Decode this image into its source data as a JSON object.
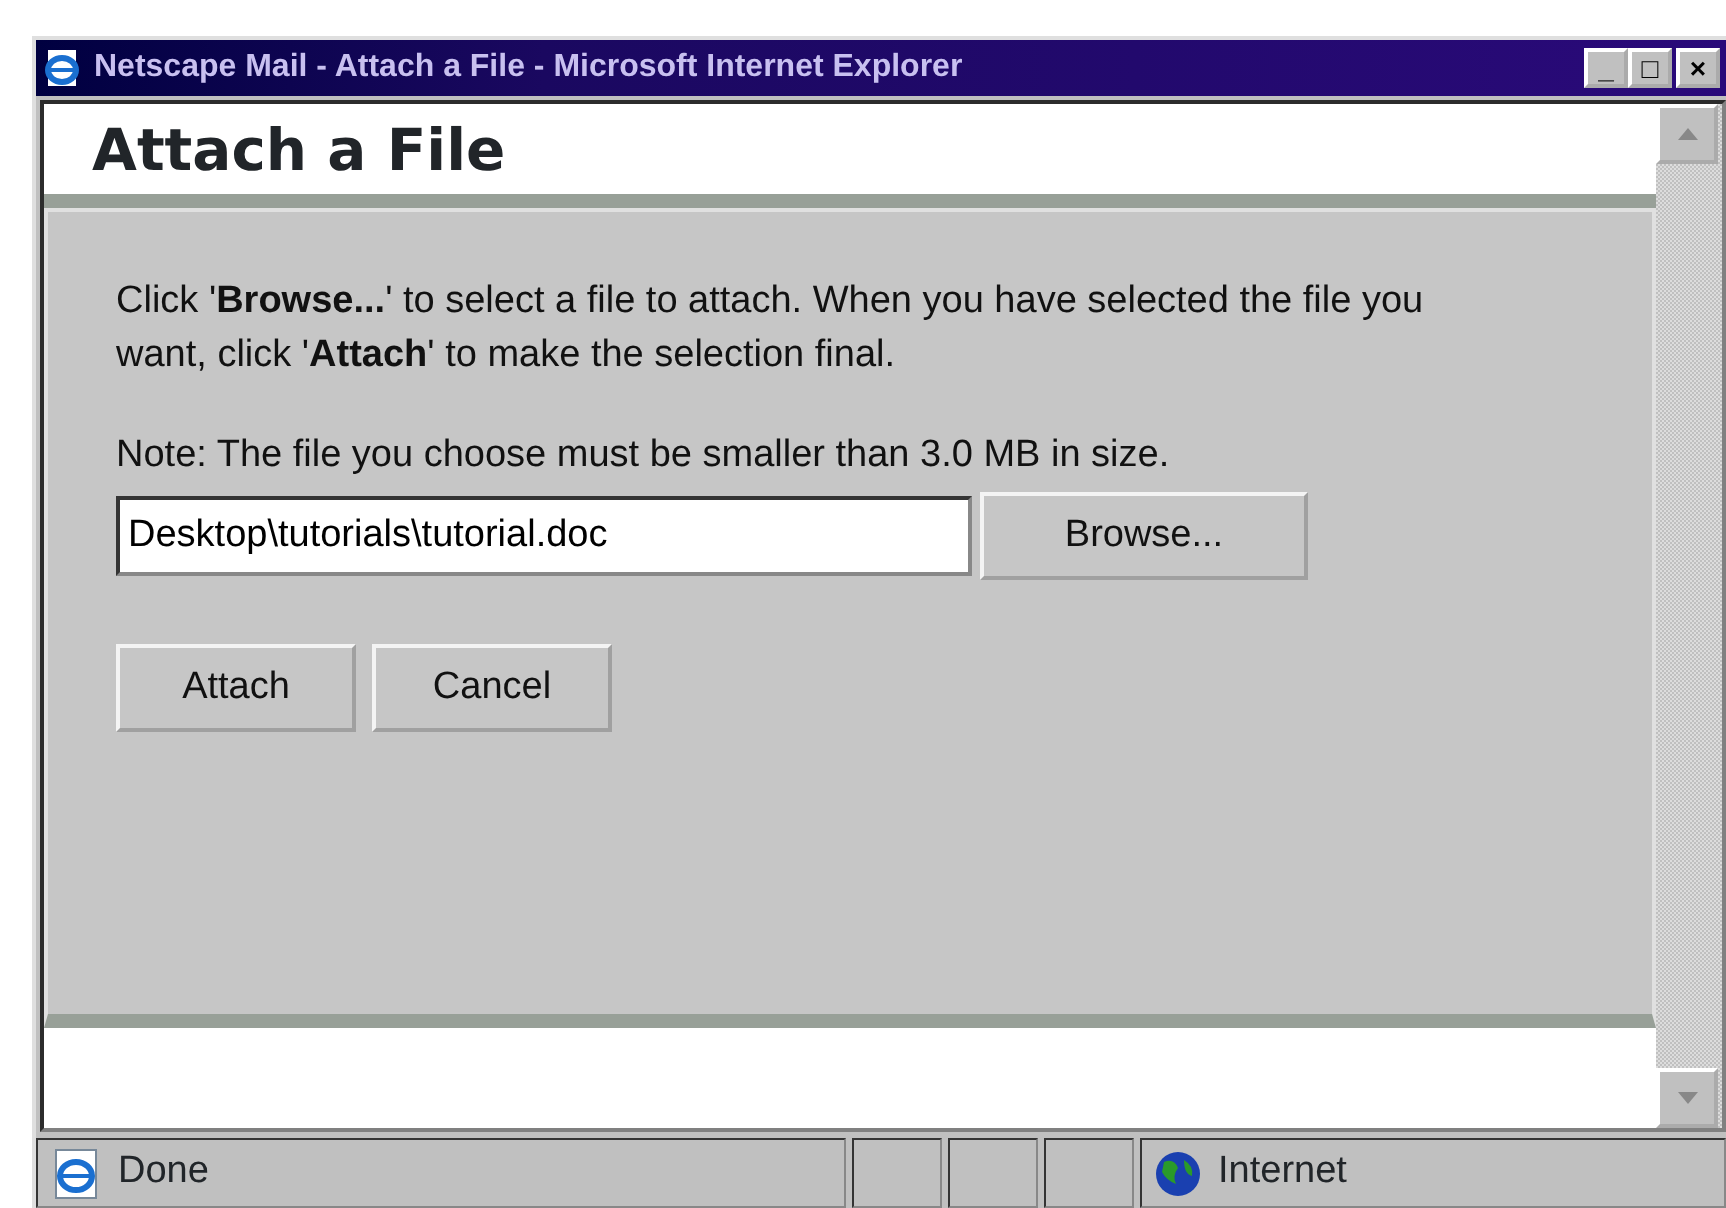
{
  "window": {
    "title": "Netscape Mail - Attach a File - Microsoft Internet Explorer",
    "controls": [
      "_",
      "□",
      "×"
    ]
  },
  "heading": "Attach a File",
  "instructions": "Click '**Browse...**' to select a file to attach. When you have selected the file you want, click '**Attach**' to make the selection final.",
  "note": "Note: The file you choose must be smaller than 3.0 MB in size.",
  "file_field": {
    "value": "Desktop\\tutorials\\tutorial.doc"
  },
  "browse_button": "Browse...",
  "buttons": [
    "Attach",
    "Cancel"
  ],
  "status_bar": {
    "status": "Done",
    "zone": "Internet"
  }
}
